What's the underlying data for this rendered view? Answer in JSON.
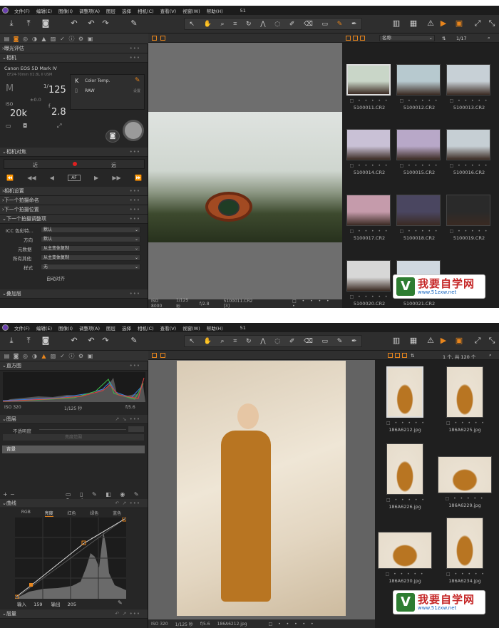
{
  "menu": [
    "文件(F)",
    "编辑(E)",
    "图像(I)",
    "调整项(A)",
    "图层",
    "选择",
    "相机(C)",
    "查看(V)",
    "视窗(W)",
    "帮助(H)"
  ],
  "window_title": "51",
  "shot1": {
    "panel_sections": {
      "exposure_eval": "曝光评估",
      "camera": "相机",
      "camera_focus": "相机对焦",
      "camera_settings": "相机设置",
      "next_naming": "下一个拍摄命名",
      "next_location": "下一个拍摄位置",
      "next_adjust": "下一个拍摄调整项",
      "overlay": "叠加层"
    },
    "camera_model": "Canon EOS 5D Mark IV",
    "lens": "EF24-70mm f/2.8L II USM",
    "mode": "M",
    "shutter_prefix": "1/",
    "shutter": "125",
    "ev": "±0.0",
    "iso_prefix": "ISO",
    "iso": "20k",
    "aperture_prefix": "f",
    "aperture": "2.8",
    "wb_k": "K",
    "wb_label": "Color Temp.",
    "raw_label": "RAW",
    "settings_label": "设置",
    "focus_near": "近",
    "focus_far": "远",
    "focus_af": "AF",
    "adjust_rows": [
      {
        "label": "ICC 色彩特...",
        "value": "默认"
      },
      {
        "label": "方向",
        "value": "默认"
      },
      {
        "label": "元数据",
        "value": "从主变体复制"
      },
      {
        "label": "所有其他",
        "value": "从主变体复制"
      },
      {
        "label": "样式",
        "value": "无"
      }
    ],
    "auto_align": "自动对齐",
    "viewer_info": {
      "iso": "ISO 8000",
      "shutter": "1/125 秒",
      "aperture": "f/2.8",
      "file": "5100011.CR2 [3]"
    },
    "sort_label": "名称",
    "counter": "1/17",
    "thumbs": [
      "5100011.CR2",
      "5100012.CR2",
      "5100013.CR2",
      "5100014.CR2",
      "5100015.CR2",
      "5100016.CR2",
      "5100017.CR2",
      "5100018.CR2",
      "5100019.CR2",
      "5100020.CR2",
      "5100021.CR2"
    ]
  },
  "shot2": {
    "panel_sections": {
      "histogram": "直方图",
      "layers": "图层",
      "curves": "曲线",
      "levels": "层量"
    },
    "hist_iso": "ISO 320",
    "hist_shutter": "1/125 秒",
    "hist_aperture": "f/5.6",
    "opacity_label": "不透明度",
    "brush_range": "亮度范围",
    "layer_bg": "背景",
    "curve_tabs": [
      "RGB",
      "亮度",
      "红色",
      "绿色",
      "蓝色"
    ],
    "curve_input_label": "输入",
    "curve_input": "159",
    "curve_output_label": "输出",
    "curve_output": "205",
    "viewer_info": {
      "iso": "ISO 320",
      "shutter": "1/125 秒",
      "aperture": "f/5.6",
      "file": "186A6212.jpg"
    },
    "counter": "1 个, 共 120 个",
    "thumbs": [
      "186A6212.jpg",
      "186A6225.jpg",
      "186A6226.jpg",
      "186A6229.jpg",
      "186A6230.jpg",
      "186A6234.jpg"
    ]
  },
  "watermark": {
    "mark": "V",
    "title": "我要自学网",
    "url": "www.51zxw.net"
  }
}
